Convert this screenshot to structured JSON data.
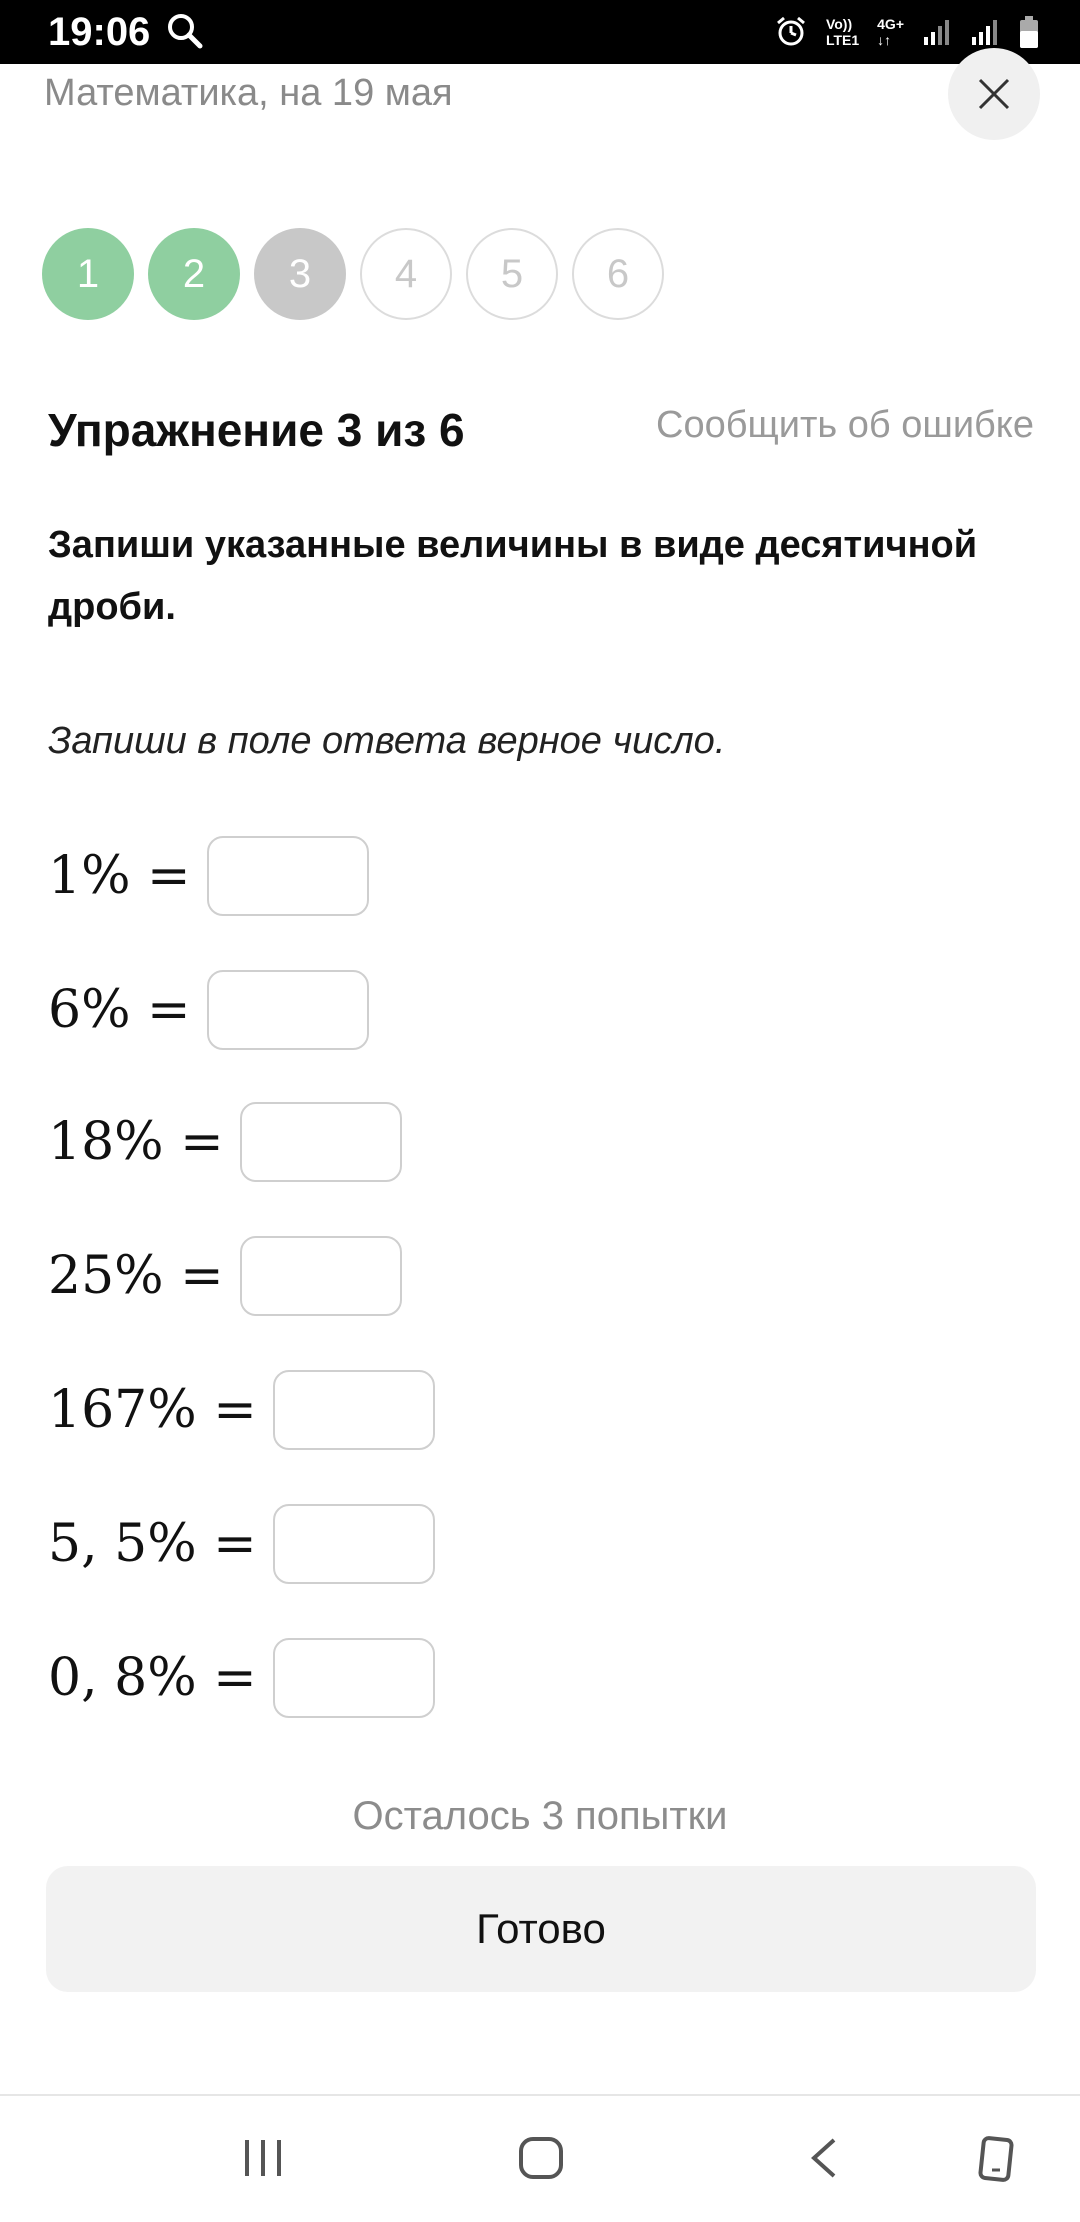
{
  "status_bar": {
    "time": "19:06",
    "volte_label": "Vo))",
    "lte_label": "LTE1",
    "net_label": "4G+"
  },
  "header": {
    "subject": "Математика, на 19 мая"
  },
  "steps": [
    {
      "label": "1",
      "state": "done"
    },
    {
      "label": "2",
      "state": "done"
    },
    {
      "label": "3",
      "state": "current"
    },
    {
      "label": "4",
      "state": "todo"
    },
    {
      "label": "5",
      "state": "todo"
    },
    {
      "label": "6",
      "state": "todo"
    }
  ],
  "exercise": {
    "title": "Упражнение 3 из 6",
    "report_label": "Сообщить об ошибке",
    "task": "Запиши указанные величины в виде десятичной дроби.",
    "hint": "Запиши в поле ответа верное число."
  },
  "equations": [
    {
      "expr": "1% =",
      "value": ""
    },
    {
      "expr": "6% =",
      "value": ""
    },
    {
      "expr": "18% =",
      "value": ""
    },
    {
      "expr": "25% =",
      "value": ""
    },
    {
      "expr": "167% =",
      "value": ""
    },
    {
      "expr": "5, 5% =",
      "value": ""
    },
    {
      "expr": "0, 8% =",
      "value": ""
    }
  ],
  "footer": {
    "attempts": "Осталось 3 попытки",
    "submit_label": "Готово"
  },
  "colors": {
    "done_step": "#8fcfa0",
    "current_step": "#c8c8c8"
  },
  "icons": {
    "status_search": "search-icon",
    "alarm": "alarm-icon",
    "close": "close-icon",
    "nav_recents": "recents-icon",
    "nav_home": "home-icon",
    "nav_back": "back-icon",
    "nav_assistant": "screen-icon"
  }
}
